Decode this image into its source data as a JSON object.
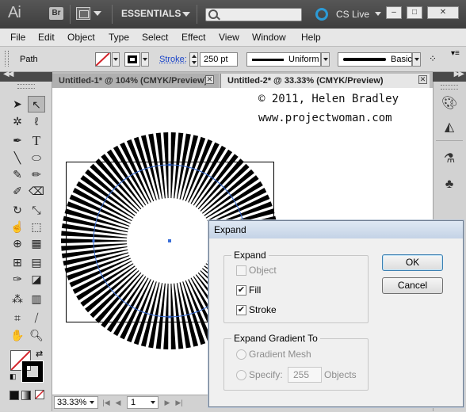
{
  "titlebar": {
    "app_logo": "Ai",
    "bridge_label": "Br",
    "workspace": "ESSENTIALS",
    "search_placeholder": "",
    "cs_live": "CS Live",
    "minimize_glyph": "–",
    "restore_glyph": "□",
    "close_glyph": "✕"
  },
  "menubar": {
    "items": [
      "File",
      "Edit",
      "Object",
      "Type",
      "Select",
      "Effect",
      "View",
      "Window",
      "Help"
    ]
  },
  "controlbar": {
    "selection_type": "Path",
    "stroke_label": "Stroke:",
    "stroke_weight": "250 pt",
    "profile": "Uniform",
    "brush": "Basic"
  },
  "tabs": [
    {
      "label": "Untitled-1* @ 104% (CMYK/Preview)",
      "active": false
    },
    {
      "label": "Untitled-2* @ 33.33% (CMYK/Preview)",
      "active": true
    }
  ],
  "canvas": {
    "copyright": "© 2011, Helen Bradley",
    "website": "www.projectwoman.com",
    "colors": {
      "stroke": "#000000",
      "selection_path": "#3a6fd8"
    }
  },
  "statusbar": {
    "zoom": "33.33%",
    "page": "1"
  },
  "dialog": {
    "title": "Expand",
    "expand_group": "Expand",
    "object_label": "Object",
    "object_checked": false,
    "object_enabled": false,
    "fill_label": "Fill",
    "fill_checked": true,
    "stroke_label": "Stroke",
    "stroke_checked": true,
    "gradient_group": "Expand Gradient To",
    "gradient_mesh_label": "Gradient Mesh",
    "specify_label": "Specify:",
    "specify_value": "255",
    "objects_label": "Objects",
    "ok_label": "OK",
    "cancel_label": "Cancel"
  },
  "icons": {
    "tools": [
      "selection-tool",
      "direct-selection-tool",
      "magic-wand-tool",
      "lasso-tool",
      "pen-tool",
      "type-tool",
      "line-tool",
      "ellipse-tool",
      "paintbrush-tool",
      "pencil-tool",
      "blob-brush-tool",
      "eraser-tool",
      "rotate-tool",
      "scale-tool",
      "warp-tool",
      "free-transform-tool",
      "shape-builder-tool",
      "perspective-grid-tool",
      "mesh-tool",
      "gradient-tool",
      "eyedropper-tool",
      "blend-tool",
      "symbol-sprayer-tool",
      "column-graph-tool",
      "artboard-tool",
      "slice-tool",
      "hand-tool",
      "zoom-tool"
    ],
    "dock": [
      "color-panel-icon",
      "color-guide-icon",
      "brushes-icon",
      "symbols-icon"
    ]
  }
}
